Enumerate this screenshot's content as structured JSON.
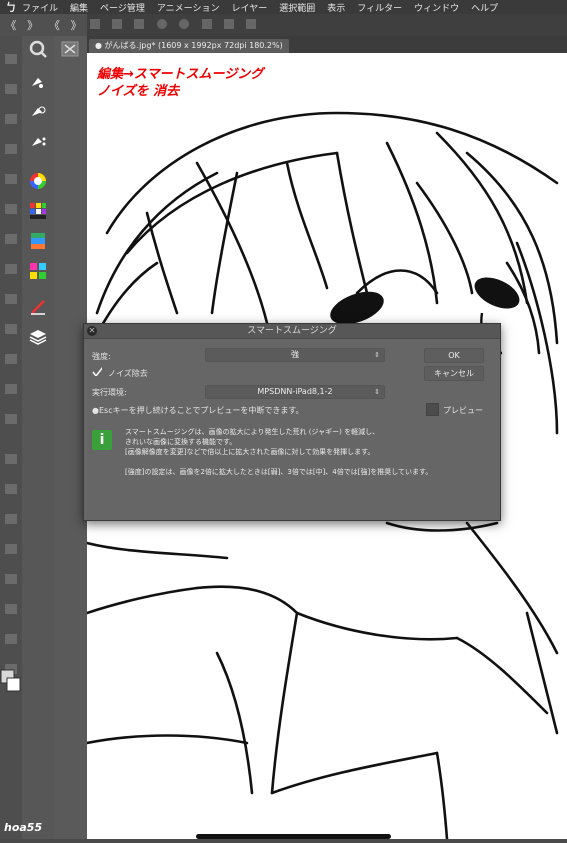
{
  "menubar": {
    "logo": "ㄅ",
    "items": [
      "ファイル",
      "編集",
      "ページ管理",
      "アニメーション",
      "レイヤー",
      "選択範囲",
      "表示",
      "フィルター",
      "ウィンドウ",
      "ヘルプ"
    ]
  },
  "toolbar": {
    "left_glyphs": [
      "《",
      "》",
      "《",
      "》"
    ]
  },
  "document_tab": {
    "label": "がんばる.jpg* (1609 x 1992px 72dpi 180.2%)"
  },
  "annotation": {
    "line1": "編集→スマートスムージング",
    "line2": "ノイズを 消去"
  },
  "dialog": {
    "title": "スマートスムージング",
    "strength_label": "強度:",
    "strength_value": "強",
    "noise_label": "ノイズ除去",
    "env_label": "実行環境:",
    "env_value": "MPSDNN-iPad8,1-2",
    "esc_note": "●Escキーを押し続けることでプレビューを中断できます。",
    "ok_label": "OK",
    "cancel_label": "キャンセル",
    "preview_label": "プレビュー",
    "info_icon": "i",
    "message_lines": [
      "スマートスムージングは、画像の拡大により発生した荒れ (ジャギー) を軽減し、",
      "きれいな画像に変換する機能です。",
      "[画像解像度を変更]などで倍以上に拡大された画像に対して効果を発揮します。",
      "",
      "[強度]の設定は、画像を2倍に拡大したときは[弱]、3倍では[中]、4倍では[強]を推奨しています。"
    ]
  },
  "watermark": "hoa55",
  "colors": {
    "annotation": "#e00000",
    "info_icon": "#3aa13a",
    "dialog_bg": "#666666"
  }
}
